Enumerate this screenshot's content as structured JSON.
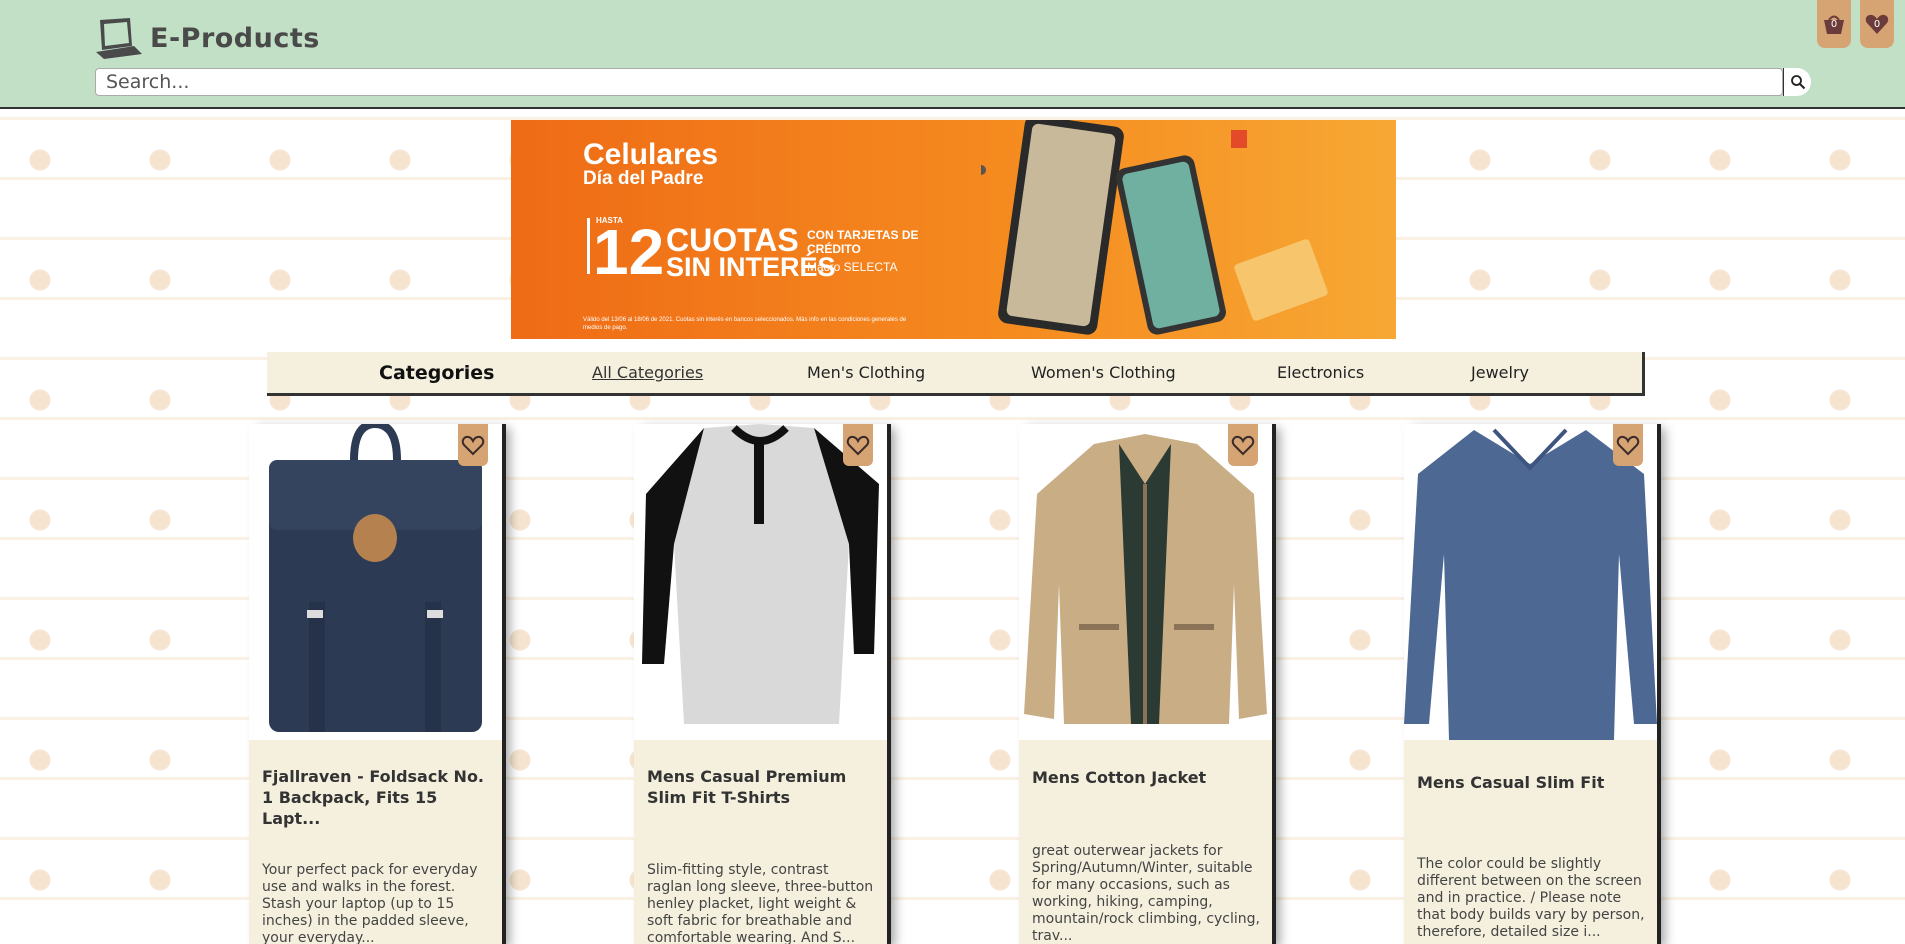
{
  "header": {
    "brand": "E-Products",
    "search_placeholder": "Search...",
    "cart_count": "0",
    "favorites_count": "0",
    "bg_color": "#c1e0c6"
  },
  "banner": {
    "title": "Celulares",
    "subtitle": "Día del Padre",
    "hasta": "HASTA",
    "number": "12",
    "cuotas": "CUOTAS",
    "sin_interes": "SIN INTERÉS",
    "tarjetas": "CON TARJETAS DE CRÉDITO",
    "macro": "Macro SELECTA",
    "legal": "Válido del 13/06 al 18/06 de 2021. Cuotas sin interés en bancos seleccionados. Más info en las condiciones generales de medios de pago."
  },
  "categories": {
    "title": "Categories",
    "items": [
      "All Categories",
      "Men's Clothing",
      "Women's Clothing",
      "Electronics",
      "Jewelry"
    ],
    "active": "All Categories"
  },
  "products": [
    {
      "title": "Fjallraven - Foldsack No. 1 Backpack, Fits 15 Lapt...",
      "description": "Your perfect pack for everyday use and walks in the forest. Stash your laptop (up to 15 inches) in the padded sleeve, your everyday..."
    },
    {
      "title": "Mens Casual Premium Slim Fit T-Shirts",
      "description": "Slim-fitting style, contrast raglan long sleeve, three-button henley placket, light weight & soft fabric for breathable and comfortable wearing. And S..."
    },
    {
      "title": "Mens Cotton Jacket",
      "description": "great outerwear jackets for Spring/Autumn/Winter, suitable for many occasions, such as working, hiking, camping, mountain/rock climbing, cycling, trav..."
    },
    {
      "title": "Mens Casual Slim Fit",
      "description": "The color could be slightly different between on the screen and in practice. / Please note that body builds vary by person, therefore, detailed size i..."
    }
  ],
  "colors": {
    "accent": "#d6a373",
    "card_bg": "#f5f0de",
    "banner_orange": "#ef6b16"
  }
}
